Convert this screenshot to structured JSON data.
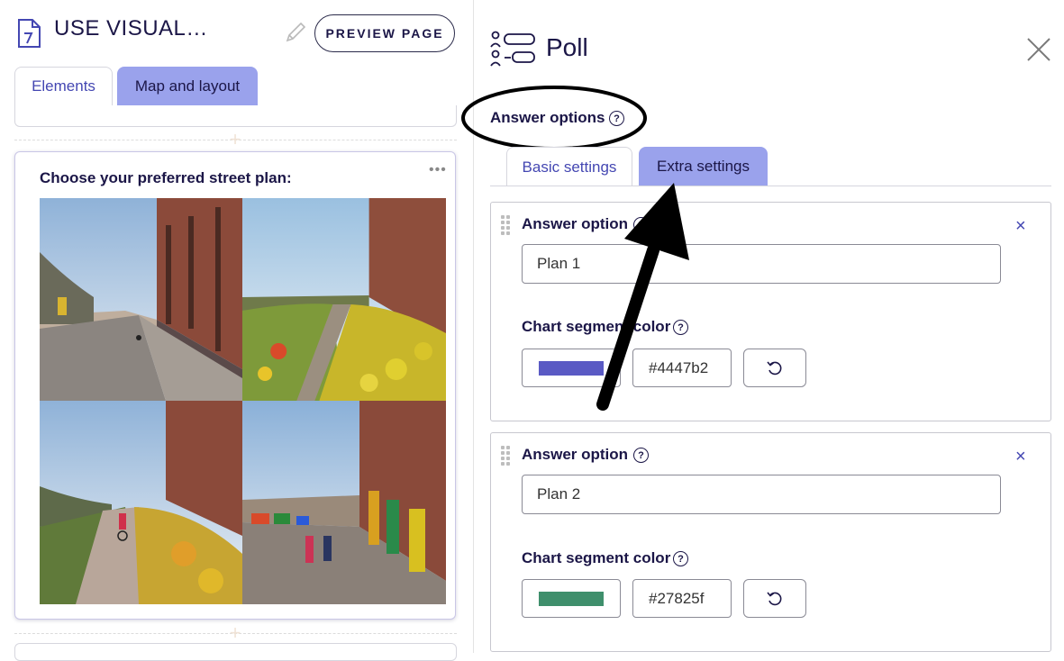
{
  "header": {
    "doc_title": "USE VISUAL…",
    "preview_label": "PREVIEW PAGE"
  },
  "left_tabs": [
    {
      "label": "Elements",
      "active": true
    },
    {
      "label": "Map and layout",
      "active": false
    }
  ],
  "poll_card": {
    "title": "Choose your preferred street plan:",
    "menu_icon": "more-horizontal-icon"
  },
  "panel": {
    "title": "Poll",
    "icon": "poll-list-icon",
    "close_icon": "close-icon",
    "section_label": "Answer options",
    "tabs": [
      {
        "label": "Basic settings",
        "active": true
      },
      {
        "label": "Extra settings",
        "active": false
      }
    ],
    "answer_options": [
      {
        "label": "Answer option",
        "value": "Plan 1",
        "color_label": "Chart segment color",
        "color_hex": "#4447b2",
        "swatch_color": "#5a5ac4"
      },
      {
        "label": "Answer option",
        "value": "Plan 2",
        "color_label": "Chart segment color",
        "color_hex": "#27825f",
        "swatch_color": "#3f8f6c"
      }
    ]
  },
  "colors": {
    "accent": "#4447b2",
    "active_tab_bg": "#9aa2ec",
    "text_dark": "#1b1647"
  }
}
